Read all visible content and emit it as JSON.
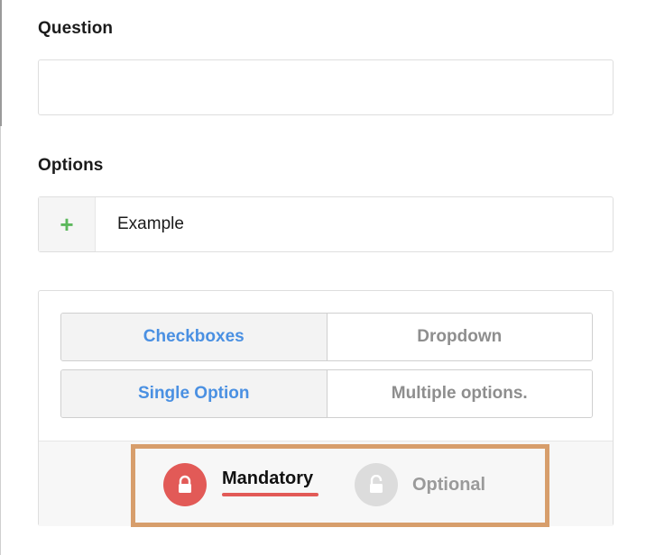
{
  "question": {
    "label": "Question",
    "value": "",
    "placeholder": ""
  },
  "options": {
    "label": "Options",
    "add_symbol": "+",
    "first_option_value": "Example"
  },
  "answer_type": {
    "items": [
      {
        "label": "Checkboxes",
        "selected": true
      },
      {
        "label": "Dropdown",
        "selected": false
      }
    ]
  },
  "selection_mode": {
    "items": [
      {
        "label": "Single Option",
        "selected": true
      },
      {
        "label": "Multiple options.",
        "selected": false
      }
    ]
  },
  "requirement": {
    "mandatory_label": "Mandatory",
    "optional_label": "Optional",
    "selected": "Mandatory"
  },
  "colors": {
    "accent_blue": "#4a90e2",
    "mandatory_red": "#e25a57",
    "add_green": "#5cb85c",
    "highlight_orange": "#d79e6c"
  },
  "icons": {
    "mandatory": "lock-closed-icon",
    "optional": "lock-open-icon",
    "add": "plus-icon"
  }
}
